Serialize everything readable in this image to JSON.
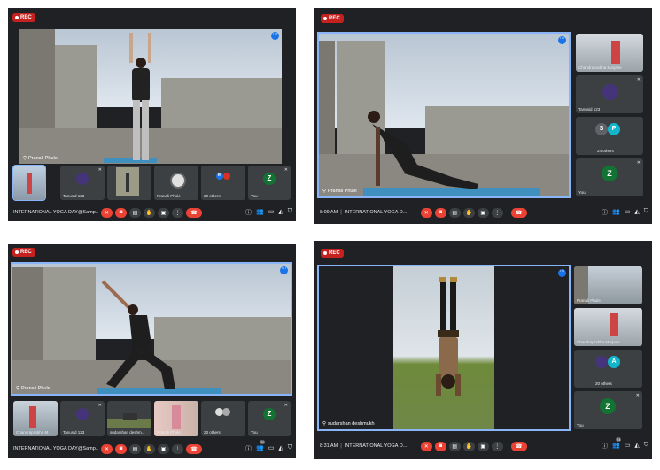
{
  "rec_label": "REC",
  "meeting_title": "INTERNATIONAL YOGA DAY@Samp...",
  "meeting_title_short": "INTERNATIONAL YOGA D...",
  "q1": {
    "presenter": "Pranali Phule",
    "tiles": [
      "",
      "Tanusid 123",
      "",
      "Pranali Phule",
      "20 others",
      "You"
    ],
    "others_avatar": "M",
    "you_avatar": "Z"
  },
  "q2": {
    "time": "8:09 AM",
    "presenter": "Pranali Phule",
    "side_tiles": [
      "Chandraprabha Marjane",
      "Tanusid 123",
      "24 others",
      "You"
    ],
    "others_avatars": [
      "S",
      "P"
    ],
    "you_avatar": "Z"
  },
  "q3": {
    "presenter": "Pranali Phule",
    "tiles": [
      "Chandraprabha M...",
      "Tanusid 123",
      "sudarshan deshm...",
      "Pranali Phule",
      "23 others",
      "You"
    ],
    "you_avatar": "Z",
    "people_count": "26"
  },
  "q4": {
    "time": "8:31 AM",
    "presenter": "sudarshan deshmukh",
    "side_tiles": [
      "Pranali Phule",
      "Chandraprabha Marjane",
      "20 others",
      "You"
    ],
    "others_avatar": "A",
    "you_avatar": "Z",
    "people_count": "24"
  },
  "colors": {
    "meet_bg": "#202124",
    "tile_bg": "#3c4043",
    "red": "#ea4335",
    "rec": "#c5221f",
    "accent": "#8ab4f8",
    "you_avatar": "#137333"
  },
  "icons": [
    "more-icon",
    "mic-off-icon",
    "camera-off-icon",
    "captions-icon",
    "raise-hand-icon",
    "present-icon",
    "more-vert-icon",
    "hangup-icon",
    "info-icon",
    "people-icon",
    "chat-icon",
    "activities-icon",
    "shield-icon",
    "pin-icon"
  ]
}
